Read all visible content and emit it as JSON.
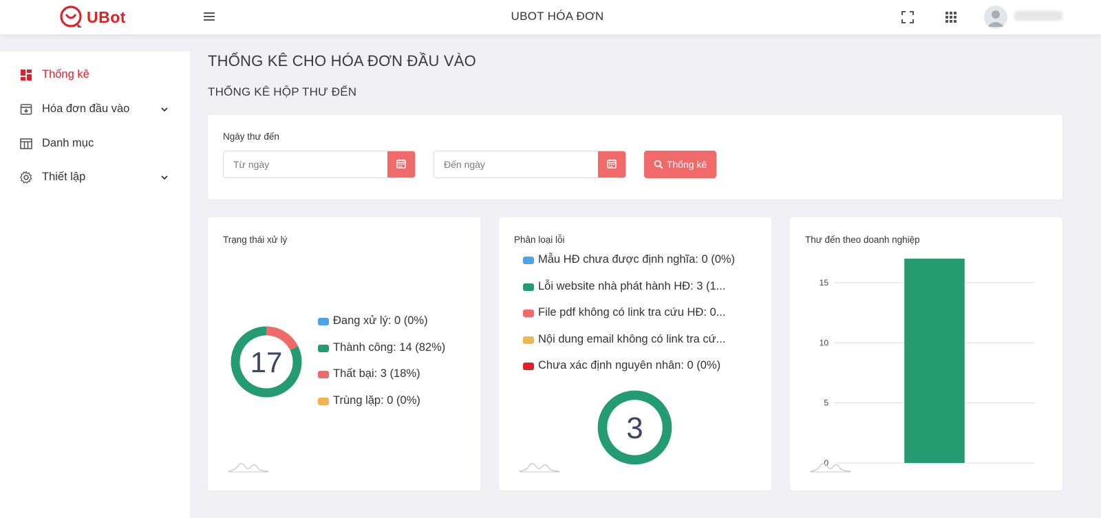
{
  "header": {
    "logo_text": "UBot",
    "app_title": "UBOT HÓA ĐƠN"
  },
  "sidebar": {
    "items": [
      {
        "label": "Thống kê",
        "icon": "dashboard-icon",
        "active": true
      },
      {
        "label": "Hóa đơn đầu vào",
        "icon": "inbox-icon",
        "expandable": true
      },
      {
        "label": "Danh mục",
        "icon": "table-icon"
      },
      {
        "label": "Thiết lập",
        "icon": "gear-icon",
        "expandable": true
      }
    ]
  },
  "page": {
    "title": "THỐNG KÊ CHO HÓA ĐƠN ĐẦU VÀO",
    "subtitle": "THỐNG KÊ HỘP THƯ ĐẾN"
  },
  "filter": {
    "label": "Ngày thư đến",
    "from_placeholder": "Từ ngày",
    "to_placeholder": "Đến ngày",
    "submit_label": "Thống kê"
  },
  "colors": {
    "accent": "#e02127",
    "button": "#f06a6a",
    "blue": "#4da3e8",
    "green": "#259b72",
    "red": "#f06a6a",
    "orange": "#f0b452",
    "dark_red": "#e02127"
  },
  "chart_data": [
    {
      "type": "pie",
      "title": "Trạng thái xử lý",
      "total_label": "17",
      "categories": [
        "Đang xử lý",
        "Thành công",
        "Thất bại",
        "Trùng lặp"
      ],
      "values": [
        0,
        14,
        3,
        0
      ],
      "legend": [
        "Đang xử lý: 0 (0%)",
        "Thành công: 14 (82%)",
        "Thất bại: 3 (18%)",
        "Trùng lặp: 0 (0%)"
      ],
      "colors": [
        "#4da3e8",
        "#259b72",
        "#f06a6a",
        "#f0b452"
      ]
    },
    {
      "type": "pie",
      "title": "Phân loại lỗi",
      "total_label": "3",
      "categories": [
        "Mẫu HĐ chưa được định nghĩa",
        "Lỗi website nhà phát hành HĐ",
        "File pdf không có link tra cứu HĐ",
        "Nội dung email không có link tra cứu",
        "Chưa xác định nguyên nhân"
      ],
      "values": [
        0,
        3,
        0,
        0,
        0
      ],
      "legend": [
        "Mẫu HĐ chưa được định nghĩa: 0 (0%)",
        "Lỗi website nhà phát hành HĐ: 3 (1...",
        "File pdf không có link tra cứu HĐ: 0...",
        "Nội dung email không có link tra cứ...",
        "Chưa xác định nguyên nhân: 0 (0%)"
      ],
      "colors": [
        "#4da3e8",
        "#259b72",
        "#f06a6a",
        "#f0b452",
        "#e02127"
      ]
    },
    {
      "type": "bar",
      "title": "Thư đến theo doanh nghiệp",
      "categories": [
        ""
      ],
      "values": [
        17
      ],
      "ylim": [
        0,
        17
      ],
      "yticks": [
        0,
        5,
        10,
        15
      ],
      "grid": true,
      "color": "#259b72"
    }
  ]
}
